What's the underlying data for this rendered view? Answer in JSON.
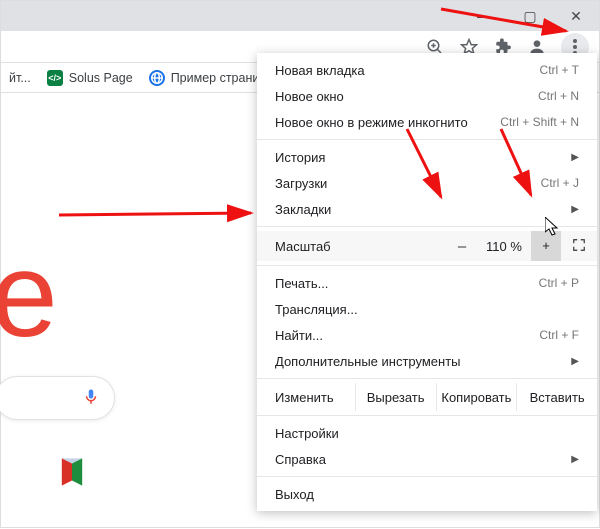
{
  "window": {
    "minimize": "—",
    "maximize": "▢",
    "close": "✕"
  },
  "toolbar": {
    "zoom_icon": "⊕",
    "star_icon": "☆",
    "ext_icon": "✦",
    "profile_icon": "◯"
  },
  "bookmarks": {
    "truncated_label": "йт...",
    "solus_label": "Solus Page",
    "example_label": "Пример страницы"
  },
  "menu": {
    "new_tab": {
      "label": "Новая вкладка",
      "shortcut": "Ctrl + T"
    },
    "new_window": {
      "label": "Новое окно",
      "shortcut": "Ctrl + N"
    },
    "incognito": {
      "label": "Новое окно в режиме инкогнито",
      "shortcut": "Ctrl + Shift + N"
    },
    "history": {
      "label": "История"
    },
    "downloads": {
      "label": "Загрузки",
      "shortcut": "Ctrl + J"
    },
    "bookmarks": {
      "label": "Закладки"
    },
    "zoom": {
      "label": "Масштаб",
      "minus": "–",
      "value": "110 %",
      "plus": "+",
      "full": "⛶"
    },
    "print": {
      "label": "Печать...",
      "shortcut": "Ctrl + P"
    },
    "cast": {
      "label": "Трансляция..."
    },
    "find": {
      "label": "Найти...",
      "shortcut": "Ctrl + F"
    },
    "moretools": {
      "label": "Дополнительные инструменты"
    },
    "edit": {
      "label": "Изменить",
      "cut": "Вырезать",
      "copy": "Копировать",
      "paste": "Вставить"
    },
    "settings": {
      "label": "Настройки"
    },
    "help": {
      "label": "Справка"
    },
    "exit": {
      "label": "Выход"
    }
  },
  "page": {
    "logo_fragment": "e"
  }
}
